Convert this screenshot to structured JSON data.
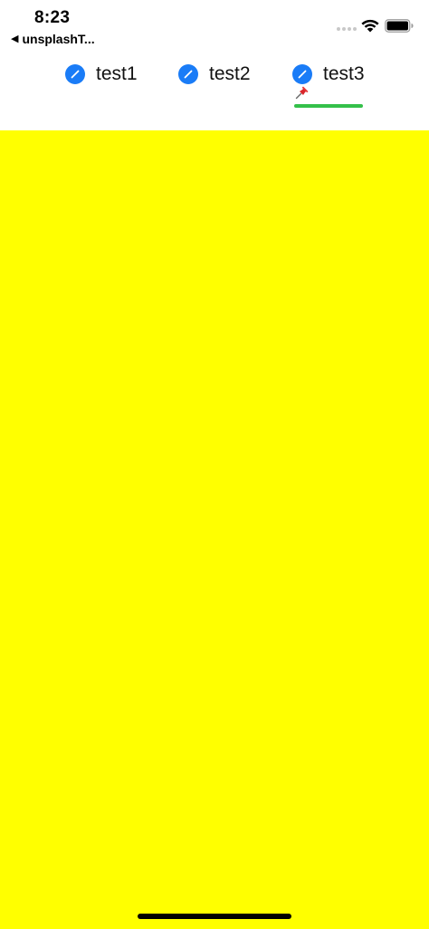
{
  "status_bar": {
    "time": "8:23",
    "back_label": "unsplashT...",
    "back_arrow": "◀"
  },
  "tabs": [
    {
      "label": "test1",
      "icon": "pencil-icon"
    },
    {
      "label": "test2",
      "icon": "pencil-icon"
    },
    {
      "label": "test3",
      "icon": "pencil-icon"
    }
  ],
  "selected_tab": "test3",
  "colors": {
    "tab_icon": "#1a7cf7",
    "indicator": "#34c04a",
    "content_background": "#ffff00"
  }
}
